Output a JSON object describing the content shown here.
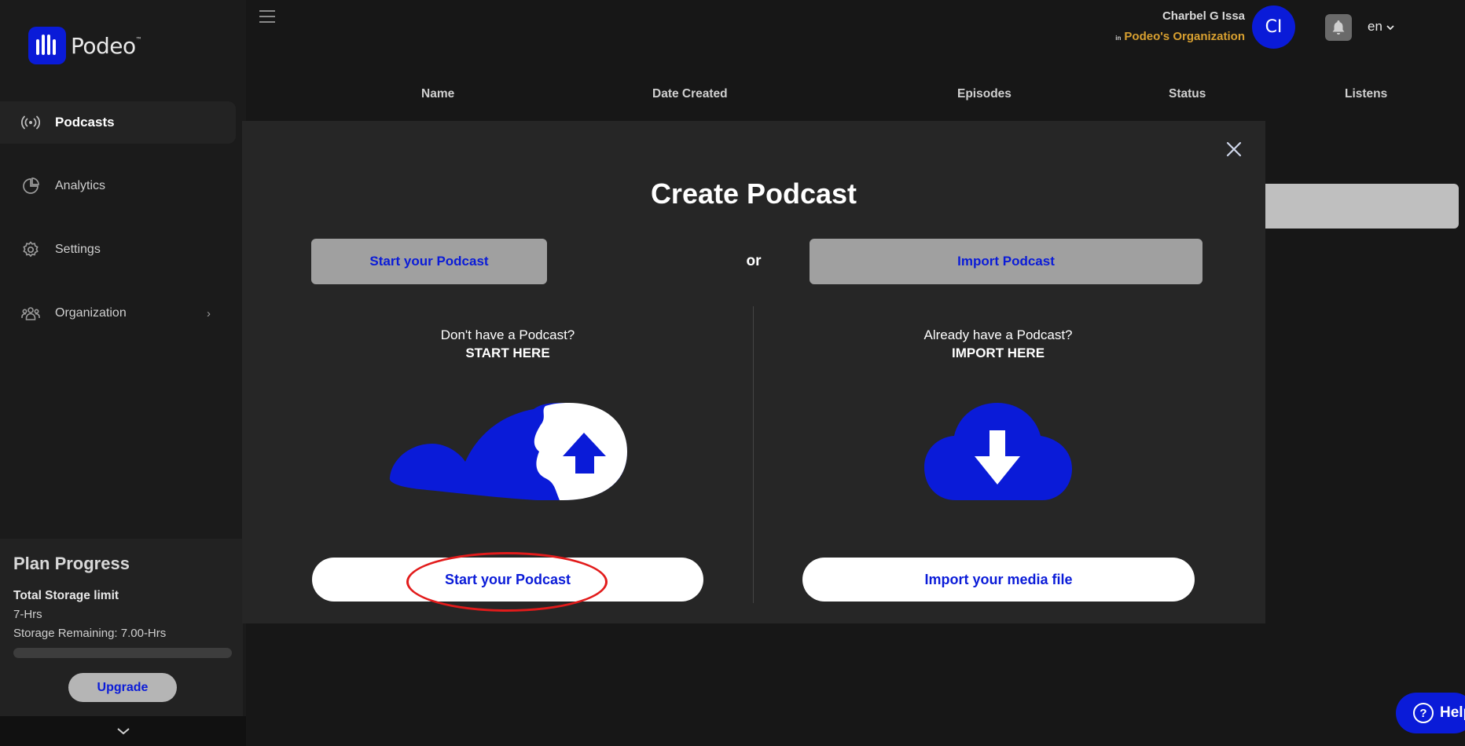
{
  "brand": {
    "name": "Podeo",
    "tm": "™",
    "color": "#0a1bd8"
  },
  "sidebar": {
    "items": [
      {
        "label": "Podcasts",
        "icon": "broadcast-icon",
        "active": true
      },
      {
        "label": "Analytics",
        "icon": "pie-chart-icon",
        "active": false
      },
      {
        "label": "Settings",
        "icon": "gear-icon",
        "active": false
      },
      {
        "label": "Organization",
        "icon": "people-icon",
        "active": false,
        "has_submenu": true
      }
    ],
    "plan": {
      "title": "Plan Progress",
      "storage_label": "Total Storage limit",
      "storage_value": "7-Hrs",
      "remaining": "Storage Remaining: 7.00-Hrs",
      "used_fraction": 0,
      "upgrade_label": "Upgrade"
    }
  },
  "header": {
    "user_name": "Charbel G Issa",
    "org_prefix": "in",
    "org_name": "Podeo's Organization",
    "avatar_initials": "CI",
    "language": "en"
  },
  "table": {
    "columns": [
      "Name",
      "Date Created",
      "Episodes",
      "Status",
      "Listens"
    ]
  },
  "modal": {
    "title": "Create Podcast",
    "tab_start": "Start your Podcast",
    "or_label": "or",
    "tab_import": "Import Podcast",
    "left": {
      "question": "Don't have a Podcast?",
      "cta_heading": "START HERE",
      "button": "Start your Podcast"
    },
    "right": {
      "question": "Already have a Podcast?",
      "cta_heading": "IMPORT HERE",
      "button": "Import your media file"
    }
  },
  "help": {
    "label": "Help"
  },
  "colors": {
    "accent": "#0a1bd8",
    "org": "#d8a030",
    "highlight": "#e21b1b"
  }
}
